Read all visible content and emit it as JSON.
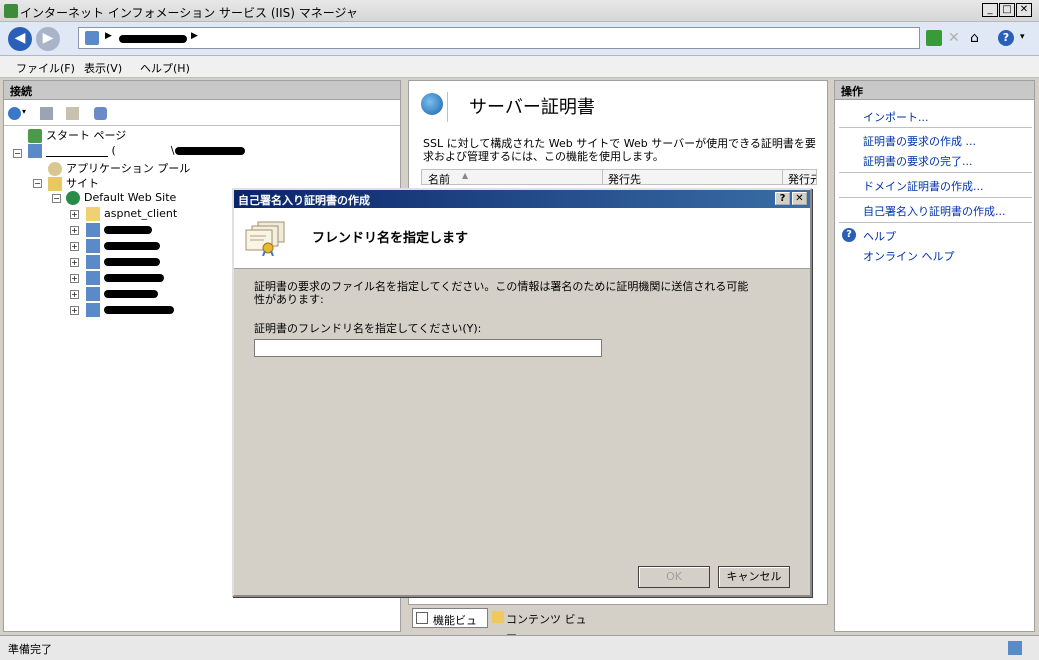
{
  "window": {
    "title": "インターネット インフォメーション サービス (IIS) マネージャ"
  },
  "menu": {
    "file": "ファイル(F)",
    "view": "表示(V)",
    "help": "ヘルプ(H)"
  },
  "connections": {
    "header": "接続",
    "start_page": "スタート ページ",
    "server_paren": "(",
    "server_sep": "\\",
    "app_pool": "アプリケーション プール",
    "sites": "サイト",
    "default_site": "Default Web Site",
    "aspnet_client": "aspnet_client"
  },
  "center": {
    "title": "サーバー証明書",
    "description": "SSL に対して構成された Web サイトで Web サーバーが使用できる証明書を要求および管理するには、この機能を使用します。",
    "columns": [
      "名前",
      "発行先",
      "発行元"
    ],
    "view_features": "機能ビュー",
    "view_content": "コンテンツ ビュー"
  },
  "actions": {
    "header": "操作",
    "import": "インポート...",
    "create_request": "証明書の要求の作成 ...",
    "complete_request": "証明書の要求の完了...",
    "create_domain": "ドメイン証明書の作成...",
    "create_selfsigned": "自己署名入り証明書の作成...",
    "help": "ヘルプ",
    "online_help": "オンライン ヘルプ"
  },
  "dialog": {
    "title": "自己署名入り証明書の作成",
    "heading": "フレンドリ名を指定します",
    "description": "証明書の要求のファイル名を指定してください。この情報は署名のために証明機関に送信される可能性があります:",
    "field_label": "証明書のフレンドリ名を指定してください(Y):",
    "field_value": "",
    "ok": "OK",
    "cancel": "キャンセル"
  },
  "status": {
    "text": "準備完了"
  },
  "colors": {
    "accent": "#0a246a",
    "link": "#0033aa"
  }
}
